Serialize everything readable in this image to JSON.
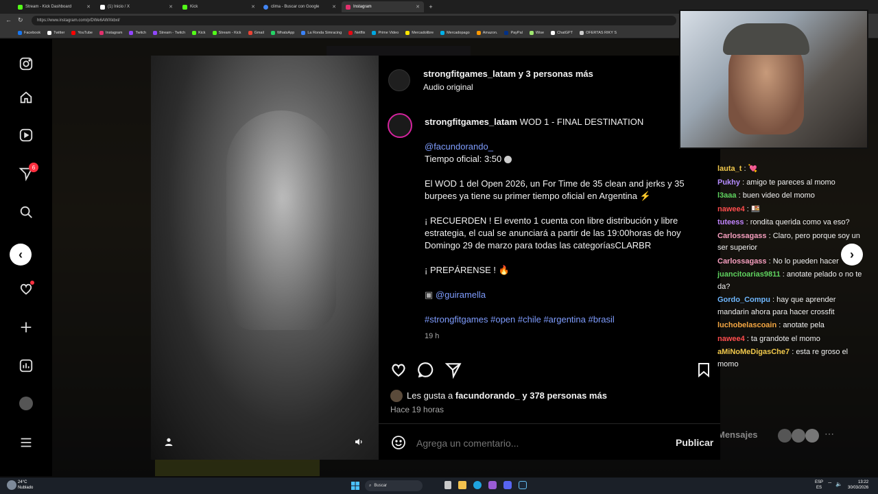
{
  "browser": {
    "tabs": [
      {
        "label": "Stream - Kick Dashboard",
        "color": "#53fc18"
      },
      {
        "label": "(1) Inicio / X",
        "color": "#ffffff"
      },
      {
        "label": "Kick",
        "color": "#53fc18"
      },
      {
        "label": "clima - Buscar con Google",
        "color": "#4285f4"
      },
      {
        "label": "Instagram",
        "color": "#e1306c"
      }
    ],
    "url": "https://www.instagram.com/p/DWe6AWXkbxl/",
    "bookmarks": [
      {
        "label": "Facebook",
        "color": "#1877f2"
      },
      {
        "label": "Twitter",
        "color": "#ffffff"
      },
      {
        "label": "YouTube",
        "color": "#ff0000"
      },
      {
        "label": "Instagram",
        "color": "#e1306c"
      },
      {
        "label": "Twitch",
        "color": "#9146ff"
      },
      {
        "label": "Stream - Twitch",
        "color": "#9146ff"
      },
      {
        "label": "Kick",
        "color": "#53fc18"
      },
      {
        "label": "Stream - Kick",
        "color": "#53fc18"
      },
      {
        "label": "Gmail",
        "color": "#ea4335"
      },
      {
        "label": "WhatsApp",
        "color": "#25d366"
      },
      {
        "label": "La Ronda Simracing",
        "color": "#3b82f6"
      },
      {
        "label": "Netflix",
        "color": "#e50914"
      },
      {
        "label": "Prime Video",
        "color": "#00a8e1"
      },
      {
        "label": "Mercadolibre",
        "color": "#ffe600"
      },
      {
        "label": "Mercadopago",
        "color": "#00b1ea"
      },
      {
        "label": "Amazon.",
        "color": "#ff9900"
      },
      {
        "label": "PayPal",
        "color": "#003087"
      },
      {
        "label": "Wise",
        "color": "#9fe870"
      },
      {
        "label": "ChatGPT",
        "color": "#ffffff"
      },
      {
        "label": "OFERTAS RIKY S",
        "color": "#cccccc"
      }
    ]
  },
  "sidebar": {
    "notification_count": "6",
    "icons": [
      "instagram-logo-icon",
      "home-icon",
      "reels-icon",
      "send-icon",
      "search-icon",
      "explore-icon",
      "heart-icon",
      "create-icon",
      "dashboard-icon",
      "profile-avatar",
      "menu-icon"
    ]
  },
  "post": {
    "header_user": "strongfitgames_latam",
    "header_with": "y 3 personas más",
    "header_audio": "Audio original",
    "caption_user": "strongfitgames_latam",
    "caption_title": "WOD 1 - FINAL DESTINATION",
    "mention1": "@facundorando_",
    "tiempo": "Tiempo oficial: 3:50",
    "para1": "El WOD 1 del Open 2026, un For Time de 35 clean and jerks y 35 burpees ya tiene su primer tiempo oficial en Argentina",
    "para2": "¡ RECUERDEN ! El evento 1 cuenta con libre distribución y libre estrategia, el cual se anunciará a partir de las 19:00horas de hoy Domingo 29 de marzo para todas las categoríasCLARBR",
    "para3": "¡ PREPÁRENSE !",
    "mention2": "@guiramella",
    "hashtags": "#strongfitgames #open #chile #argentina #brasil",
    "age": "19 h",
    "likes_prefix": "Les gusta a",
    "likes_user": "facundorando_",
    "likes_suffix": "y 378 personas más",
    "posted": "Hace 19 horas",
    "comment_placeholder": "Agrega un comentario...",
    "publish_label": "Publicar"
  },
  "chat": [
    {
      "user": "lauta_t",
      "color": "#f2c94c",
      "text": "💘"
    },
    {
      "user": "Pukhy",
      "color": "#b58cff",
      "text": "amigo te pareces al momo"
    },
    {
      "user": "l3aaa",
      "color": "#5fd35f",
      "text": "buen video del momo"
    },
    {
      "user": "nawee4",
      "color": "#ff4d4d",
      "text": "🍱"
    },
    {
      "user": "tuteess",
      "color": "#c084fc",
      "text": "rondita querida como va eso?"
    },
    {
      "user": "Carlossagass",
      "color": "#f79fbf",
      "text": "Claro, pero porque soy un ser superior"
    },
    {
      "user": "Carlossagass",
      "color": "#f79fbf",
      "text": "No lo pueden hacer"
    },
    {
      "user": "juancitoarias9811",
      "color": "#5fd35f",
      "text": "anotate pelado o no te da?"
    },
    {
      "user": "Gordo_Compu",
      "color": "#6fb7ff",
      "text": "hay que aprender mandarin ahora para hacer crossfit"
    },
    {
      "user": "luchobelascoain",
      "color": "#f5a742",
      "text": "anotate pela"
    },
    {
      "user": "nawee4",
      "color": "#ff4d4d",
      "text": "ta grandote el momo"
    },
    {
      "user": "aMiNoMeDigasChe7",
      "color": "#f2c94c",
      "text": "esta re groso el momo"
    }
  ],
  "backdrop": {
    "messages_label": "Mensajes"
  },
  "taskbar": {
    "weather_temp": "24°C",
    "weather_desc": "Nublado",
    "search_label": "Buscar",
    "lang": "ESP",
    "lang_sub": "ES",
    "time": "13:22",
    "date": "30/03/2026"
  }
}
